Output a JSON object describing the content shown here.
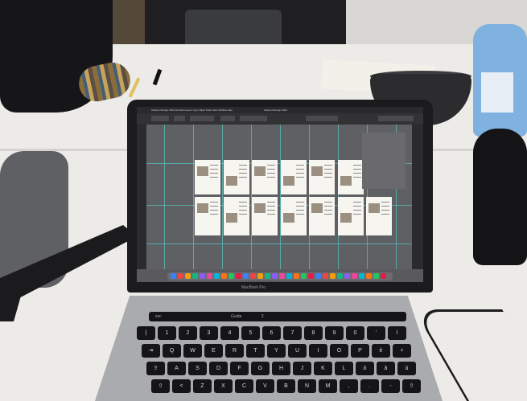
{
  "photo": {
    "laptop_model_label": "MacBook Pro",
    "touchbar_labels": [
      "esc",
      "Guida",
      "Σ"
    ],
    "keyboard_rows": [
      [
        "|",
        "1",
        "2",
        "3",
        "4",
        "5",
        "6",
        "7",
        "8",
        "9",
        "0",
        "'",
        "ì"
      ],
      [
        "⇥",
        "Q",
        "W",
        "E",
        "R",
        "T",
        "Y",
        "U",
        "I",
        "O",
        "P",
        "è",
        "+"
      ],
      [
        "⇪",
        "A",
        "S",
        "D",
        "F",
        "G",
        "H",
        "J",
        "K",
        "L",
        "ò",
        "à",
        "ù"
      ],
      [
        "⇧",
        "<",
        "Z",
        "X",
        "C",
        "V",
        "B",
        "N",
        "M",
        ",",
        ".",
        "-",
        "⇧"
      ]
    ],
    "screen": {
      "app_menu": "Adobe InDesign 2022  File  Edit  Layout  Type  Object  Table  View  Window  Help",
      "doc_title": "Adobe InDesign 2022",
      "artboard_rows": 2,
      "artboards_per_row": 6
    },
    "colors": {
      "guide": "#56c8c0",
      "screen_bg": "#5a5a5e",
      "lid": "#1b1b1d"
    }
  }
}
